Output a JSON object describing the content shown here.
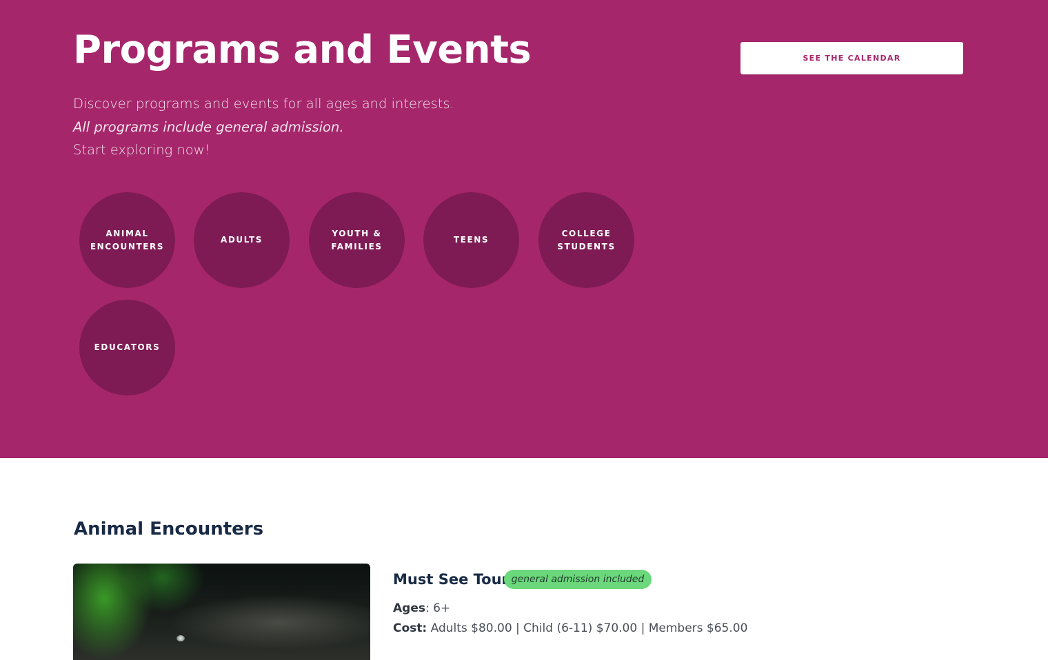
{
  "hero": {
    "title": "Programs and Events",
    "calendar_button": "SEE THE CALENDAR",
    "description": [
      "Discover programs and events for all ages and interests.",
      "All programs include general admission.",
      "Start exploring now!"
    ],
    "categories": [
      {
        "line1": "ANIMAL",
        "line2": "ENCOUNTERS"
      },
      {
        "line1": "ADULTS",
        "line2": ""
      },
      {
        "line1": "YOUTH &",
        "line2": "FAMILIES"
      },
      {
        "line1": "TEENS",
        "line2": ""
      },
      {
        "line1": "COLLEGE",
        "line2": "STUDENTS"
      },
      {
        "line1": "EDUCATORS",
        "line2": ""
      }
    ]
  },
  "section": {
    "title": "Animal Encounters",
    "program": {
      "title": "Must See Tour",
      "badge": "general admission included",
      "ages_label": "Ages",
      "ages_value": ": 6+",
      "cost_label": "Cost:",
      "cost_value": " Adults $80.00 | Child (6-11) $70.00 | Members $65.00"
    }
  },
  "colors": {
    "hero_background": "#a6266b",
    "category_circle": "#7e1b54",
    "heading_text": "#182a45",
    "badge_background": "#6bd87c"
  }
}
